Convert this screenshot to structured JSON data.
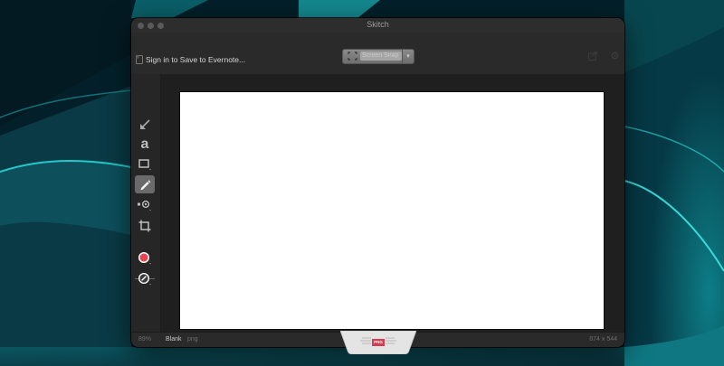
{
  "window": {
    "title": "Skitch"
  },
  "toolbar": {
    "signin_label": "Sign in to Save to Evernote...",
    "screensnap_label": "Screen Snap",
    "screensnap_dropdown_icon": "chevron-down-icon"
  },
  "tools": [
    {
      "name": "arrow-tool",
      "icon": "arrow-icon"
    },
    {
      "name": "text-tool",
      "icon": "text-icon",
      "glyph": "a"
    },
    {
      "name": "shape-tool",
      "icon": "rectangle-icon"
    },
    {
      "name": "pen-tool",
      "icon": "pencil-icon",
      "active": true
    },
    {
      "name": "pixelate-tool",
      "icon": "pixelate-icon"
    },
    {
      "name": "crop-tool",
      "icon": "crop-icon"
    }
  ],
  "colors": {
    "accent_red": "#e8434f",
    "canvas_bg": "#ffffff",
    "window_bg": "#262626"
  },
  "statusbar": {
    "zoom": "89%",
    "file_name": "Blank",
    "file_type": "png",
    "dimensions": "874 x 544"
  },
  "drag_tab": {
    "badge": "PNG"
  }
}
